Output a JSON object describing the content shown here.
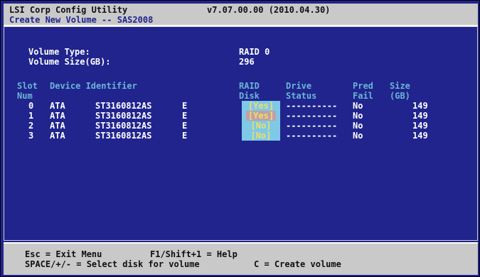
{
  "header": {
    "app_title": "LSI Corp Config Utility",
    "version": "v7.07.00.00 (2010.04.30)",
    "subtitle": "Create New Volume -- SAS2008"
  },
  "volume": {
    "type_label": "Volume Type:",
    "type_value": "RAID 0",
    "size_label": "Volume Size(GB):",
    "size_value": "296"
  },
  "table": {
    "headers": {
      "slot_line1": "Slot",
      "slot_line2": "Num",
      "device_identifier": "Device Identifier",
      "raid_line1": "RAID",
      "raid_line2": "Disk",
      "drive_line1": "Drive",
      "drive_line2": "Status",
      "pred_line1": "Pred",
      "pred_line2": "Fail",
      "size_line1": "Size",
      "size_line2": "(GB)"
    },
    "rows": [
      {
        "slot": "0",
        "vendor": "ATA",
        "model": "ST3160812AS",
        "rev": "E",
        "raid": "[Yes]",
        "status": "----------",
        "pred_fail": "No",
        "size": "149"
      },
      {
        "slot": "1",
        "vendor": "ATA",
        "model": "ST3160812AS",
        "rev": "E",
        "raid": "[Yes]",
        "status": "----------",
        "pred_fail": "No",
        "size": "149"
      },
      {
        "slot": "2",
        "vendor": "ATA",
        "model": "ST3160812AS",
        "rev": "E",
        "raid": "[No]",
        "status": "----------",
        "pred_fail": "No",
        "size": "149"
      },
      {
        "slot": "3",
        "vendor": "ATA",
        "model": "ST3160812AS",
        "rev": "E",
        "raid": "[No]",
        "status": "----------",
        "pred_fail": "No",
        "size": "149"
      }
    ]
  },
  "footer": {
    "line1_left": "Esc = Exit Menu",
    "line1_right": "F1/Shift+1 = Help",
    "line2_left": "SPACE/+/- = Select disk for volume",
    "line2_right": "C = Create volume"
  },
  "colors": {
    "background": "#20248c",
    "bar": "#c9c9c9",
    "raid_cell": "#7ec8e8",
    "raid_cell_selected": "#c0a0a8",
    "raid_text": "#f0e060"
  }
}
